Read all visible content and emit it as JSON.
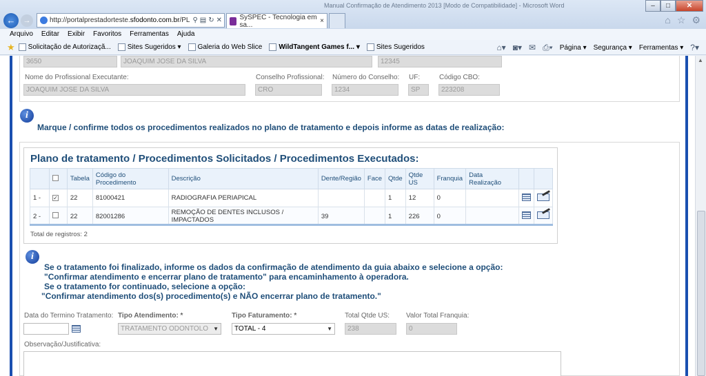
{
  "browser": {
    "window_title": "Manual Confirmação de Atendimento 2013 [Modo de Compatibilidade] - Microsoft Word",
    "url_prefix": "http://portalprestadorteste.",
    "url_host": "sfodonto.com.br",
    "url_suffix": "/PL",
    "tab_title": "SySPEC - Tecnologia em sa...",
    "tab_close": "×",
    "menu": [
      "Arquivo",
      "Editar",
      "Exibir",
      "Favoritos",
      "Ferramentas",
      "Ajuda"
    ],
    "favorites": [
      "Solicitação de Autorizaçã...",
      "Sites Sugeridos ▾",
      "Galeria do Web Slice",
      "WildTangent Games f... ▾",
      "Sites Sugeridos"
    ],
    "commands": [
      "Página ▾",
      "Segurança ▾",
      "Ferramentas ▾"
    ]
  },
  "professional": {
    "top_values": [
      "3650",
      "JOAQUIM JOSE DA SILVA",
      "12345"
    ],
    "labels": {
      "name": "Nome do Profissional Executante:",
      "council": "Conselho Profissional:",
      "council_number": "Número do Conselho:",
      "uf": "UF:",
      "cbo": "Código CBO:"
    },
    "values": {
      "name": "JOAQUIM JOSE DA SILVA",
      "council": "CRO",
      "council_number": "1234",
      "uf": "SP",
      "cbo": "223208"
    }
  },
  "info1": "Marque / confirme todos os procedimentos realizados no plano de tratamento e depois informe as datas de realização:",
  "plano": {
    "title": "Plano de tratamento / Procedimentos Solicitados / Procedimentos Executados:",
    "headers": [
      "",
      "",
      "Tabela",
      "Código do Procedimento",
      "Descrição",
      "Dente/Região",
      "Face",
      "Qtde",
      "Qtde US",
      "Franquia",
      "Data Realização",
      "",
      ""
    ],
    "rows": [
      {
        "num": "1 -",
        "checked": "✓",
        "tabela": "22",
        "codigo": "81000421",
        "descricao": "RADIOGRAFIA PERIAPICAL",
        "dente": "",
        "face": "",
        "qtde": "1",
        "qtde_us": "12",
        "franquia": "0",
        "data": ""
      },
      {
        "num": "2 -",
        "checked": "",
        "tabela": "22",
        "codigo": "82001286",
        "descricao": "REMOÇÃO DE DENTES INCLUSOS / IMPACTADOS",
        "dente": "39",
        "face": "",
        "qtde": "1",
        "qtde_us": "226",
        "franquia": "0",
        "data": ""
      }
    ],
    "total": "Total de registros: 2"
  },
  "info2": {
    "line1": "Se o tratamento foi finalizado, informe os dados da confirmação de atendimento da guia abaixo e selecione a opção:",
    "line2": "\"Confirmar atendimento e encerrar plano de tratamento\" para encaminhamento à operadora.",
    "line3": "Se o tratamento for continuado, selecione a opção:",
    "line4": "\"Confirmar atendimento dos(s) procedimento(s) e NÃO encerrar plano de tratamento.\""
  },
  "form": {
    "data_termino_label": "Data do Termino Tratamento:",
    "data_termino_value": "",
    "tipo_atendimento_label": "Tipo Atendimento: *",
    "tipo_atendimento_value": "TRATAMENTO ODONTOLO",
    "tipo_faturamento_label": "Tipo Faturamento: *",
    "tipo_faturamento_value": "TOTAL - 4",
    "total_us_label": "Total Qtde US:",
    "total_us_value": "238",
    "valor_franquia_label": "Valor Total Franquia:",
    "valor_franquia_value": "0",
    "observacao_label": "Observação/Justificativa:",
    "observacao_value": ""
  },
  "colors": {
    "accent": "#1f4e79",
    "border": "#1a4fb0"
  }
}
